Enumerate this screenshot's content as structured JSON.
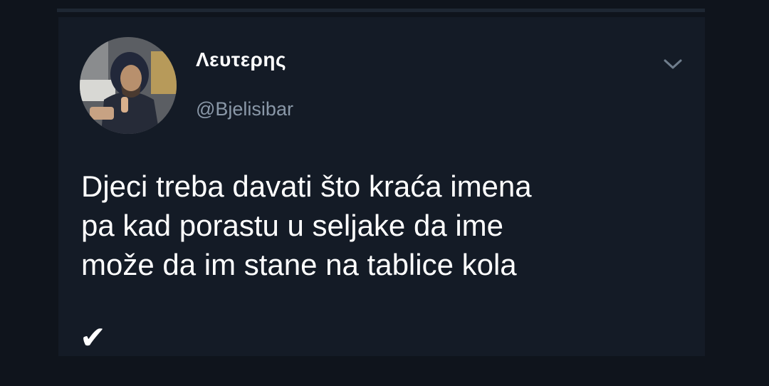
{
  "tweet": {
    "display_name": "Λευτερης",
    "handle": "@Bjelisibar",
    "text": "Djeci treba davati što kraća imena\npa kad porastu u seljake da ime\nmože da im stane na tablice kola",
    "emoji": "✔"
  },
  "icons": {
    "menu": "chevron-down-icon"
  },
  "colors": {
    "background": "#0f141c",
    "card": "#141b26",
    "text": "#ffffff",
    "muted": "#8a98a8"
  }
}
